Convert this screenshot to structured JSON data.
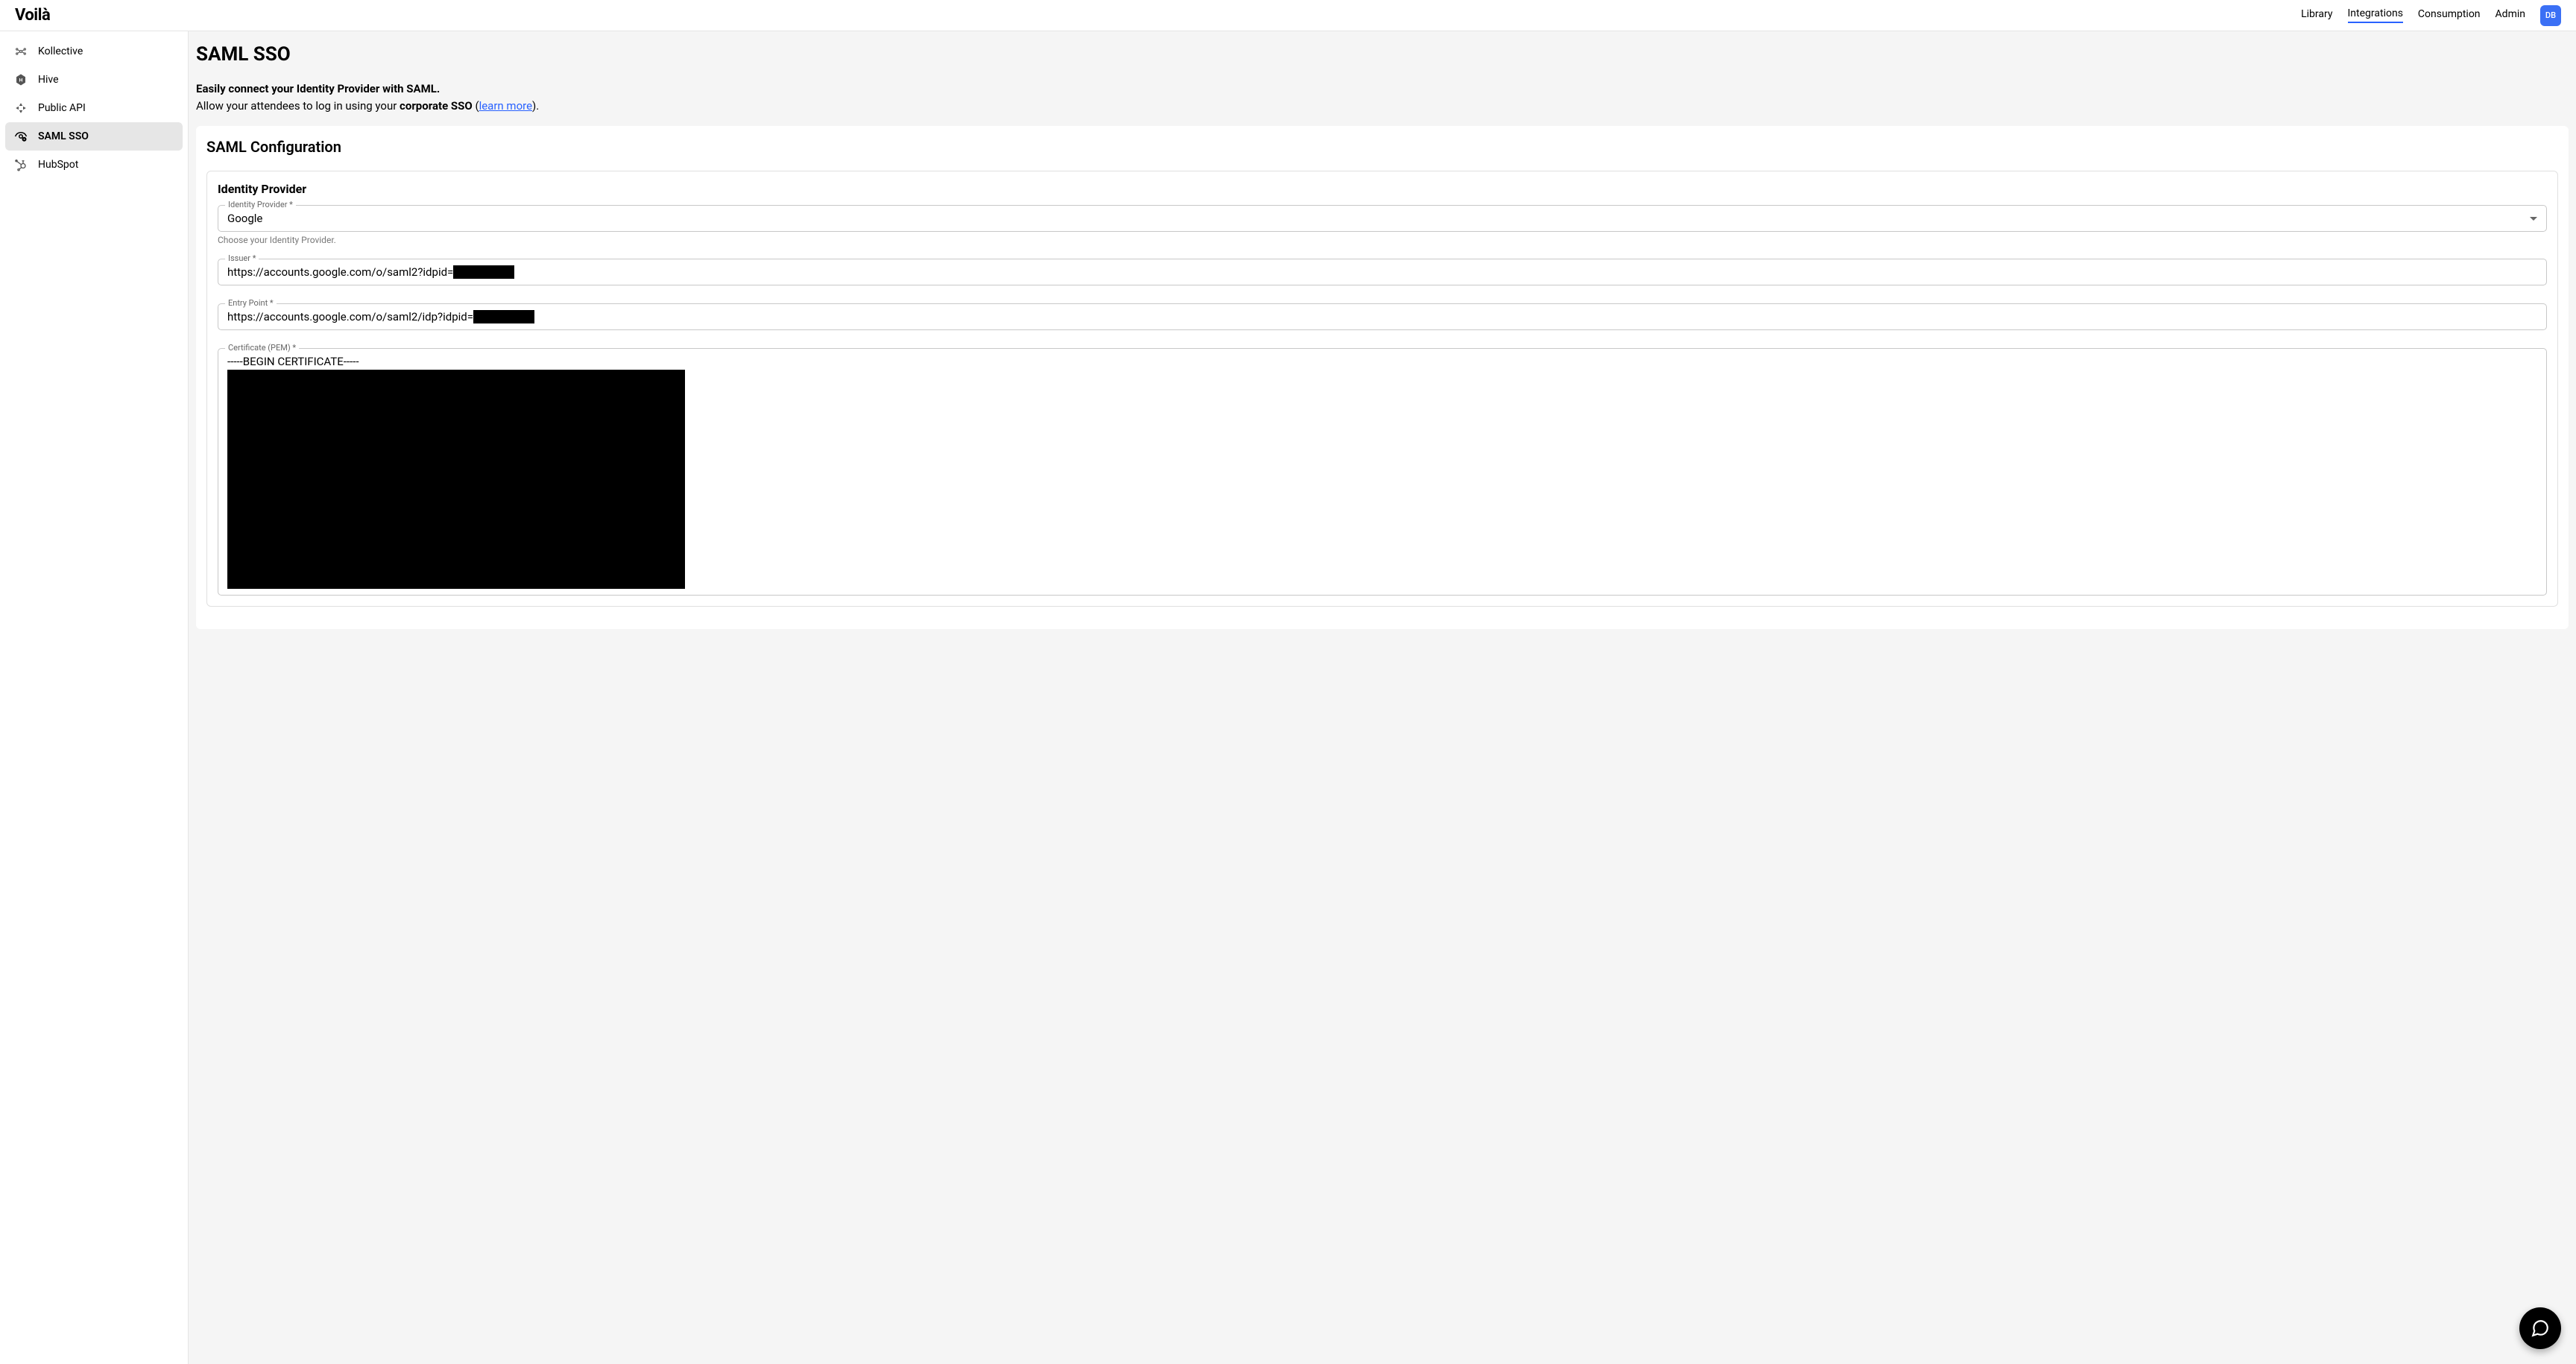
{
  "brand": "Voilà",
  "nav": {
    "items": [
      "Library",
      "Integrations",
      "Consumption",
      "Admin"
    ],
    "active_index": 1
  },
  "user": {
    "initials": "DB"
  },
  "sidebar": {
    "items": [
      {
        "label": "Kollective"
      },
      {
        "label": "Hive"
      },
      {
        "label": "Public API"
      },
      {
        "label": "SAML SSO"
      },
      {
        "label": "HubSpot"
      }
    ],
    "active_index": 3
  },
  "page": {
    "title": "SAML SSO",
    "intro_bold": "Easily connect your Identity Provider with SAML.",
    "intro_prefix": "Allow your attendees to log in using your ",
    "intro_corporate": "corporate SSO",
    "intro_paren_open": " (",
    "intro_link": "learn more",
    "intro_paren_close": ")."
  },
  "config": {
    "card_title": "SAML Configuration",
    "panel_title": "Identity Provider",
    "fields": {
      "provider": {
        "label": "Identity Provider *",
        "value": "Google",
        "helper": "Choose your Identity Provider."
      },
      "issuer": {
        "label": "Issuer *",
        "prefix": "https://accounts.google.com/o/saml2?idpid="
      },
      "entry_point": {
        "label": "Entry Point *",
        "prefix": "https://accounts.google.com/o/saml2/idp?idpid="
      },
      "cert": {
        "label": "Certificate (PEM) *",
        "begin": "-----BEGIN CERTIFICATE-----"
      }
    }
  }
}
